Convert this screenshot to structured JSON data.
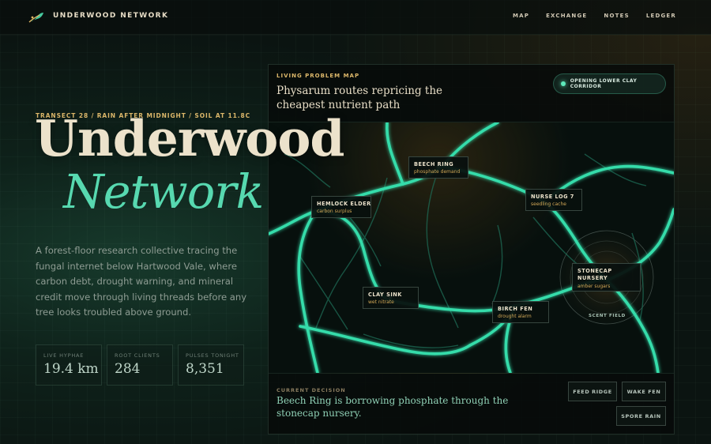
{
  "header": {
    "brand": "UNDERWOOD NETWORK",
    "logo_icon": "mycelium-leaf-icon",
    "nav": [
      "MAP",
      "EXCHANGE",
      "NOTES",
      "LEDGER"
    ]
  },
  "hero": {
    "kicker": "TRANSECT 28 / RAIN AFTER MIDNIGHT / SOIL AT 11.8C",
    "title_line1": "Underwood",
    "title_line2": "Network",
    "intro": "A forest-floor research collective tracing the fungal internet below Hartwood Vale, where carbon debt, drought warning, and mineral credit move through living threads before any tree looks troubled above ground."
  },
  "stats": [
    {
      "label": "LIVE HYPHAE",
      "value": "19.4 km"
    },
    {
      "label": "ROOT CLIENTS",
      "value": "284"
    },
    {
      "label": "PULSES TONIGHT",
      "value": "8,351"
    }
  ],
  "map_panel": {
    "kicker": "LIVING PROBLEM MAP",
    "title": "Physarum routes repricing the cheapest nutrient path",
    "status": "OPENING LOWER CLAY CORRIDOR",
    "nodes": [
      {
        "name": "BEECH RING",
        "sub": "phosphate demand"
      },
      {
        "name": "HEMLOCK ELDER",
        "sub": "carbon surplus"
      },
      {
        "name": "NURSE LOG 7",
        "sub": "seedling cache"
      },
      {
        "name": "STONECAP NURSERY",
        "sub": "amber sugars"
      },
      {
        "name": "CLAY SINK",
        "sub": "wet nitrate"
      },
      {
        "name": "BIRCH FEN",
        "sub": "drought alarm"
      }
    ],
    "scent_label": "SCENT FIELD",
    "decision_kicker": "CURRENT DECISION",
    "decision_text": "Beech Ring is borrowing phosphate through the stonecap nursery.",
    "actions": [
      "FEED RIDGE",
      "WAKE FEN",
      "SPORE RAIN"
    ]
  },
  "colors": {
    "accent": "#57d9b0",
    "gold": "#dcb76a",
    "cream": "#ece2cb",
    "background": "#0b1411"
  }
}
